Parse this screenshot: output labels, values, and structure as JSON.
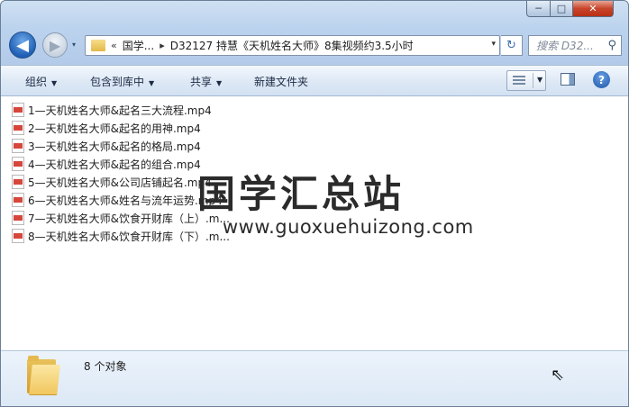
{
  "window": {
    "controls": {
      "minimize": "─",
      "maximize": "□",
      "close": "✕"
    }
  },
  "nav": {
    "back_icon": "◀",
    "forward_icon": "▶",
    "recent_icon": "▾",
    "address": {
      "overflow": "«",
      "crumb1": "国学...",
      "crumb2": "D32127 持慧《天机姓名大师》8集视频约3.5小时",
      "separator": "▸",
      "dropdown": "▾"
    },
    "refresh_icon": "↻",
    "search_placeholder": "搜索 D32...",
    "search_icon": "⚲"
  },
  "toolbar": {
    "organize": "组织",
    "include_library": "包含到库中",
    "share": "共享",
    "new_folder": "新建文件夹",
    "dropdown_arrow": "▼",
    "help": "?"
  },
  "files": [
    {
      "name": "1—天机姓名大师&起名三大流程.mp4"
    },
    {
      "name": "2—天机姓名大师&起名的用神.mp4"
    },
    {
      "name": "3—天机姓名大师&起名的格局.mp4"
    },
    {
      "name": "4—天机姓名大师&起名的组合.mp4"
    },
    {
      "name": "5—天机姓名大师&公司店铺起名.mp4"
    },
    {
      "name": "6—天机姓名大师&姓名与流年运势.mp4"
    },
    {
      "name": "7—天机姓名大师&饮食开财库（上）.m..."
    },
    {
      "name": "8—天机姓名大师&饮食开财库（下）.m..."
    }
  ],
  "watermark": {
    "chinese": "国学汇总站",
    "url": "www.guoxuehuizong.com"
  },
  "details": {
    "item_count": "8 个对象",
    "cursor_icon": "⇖"
  }
}
